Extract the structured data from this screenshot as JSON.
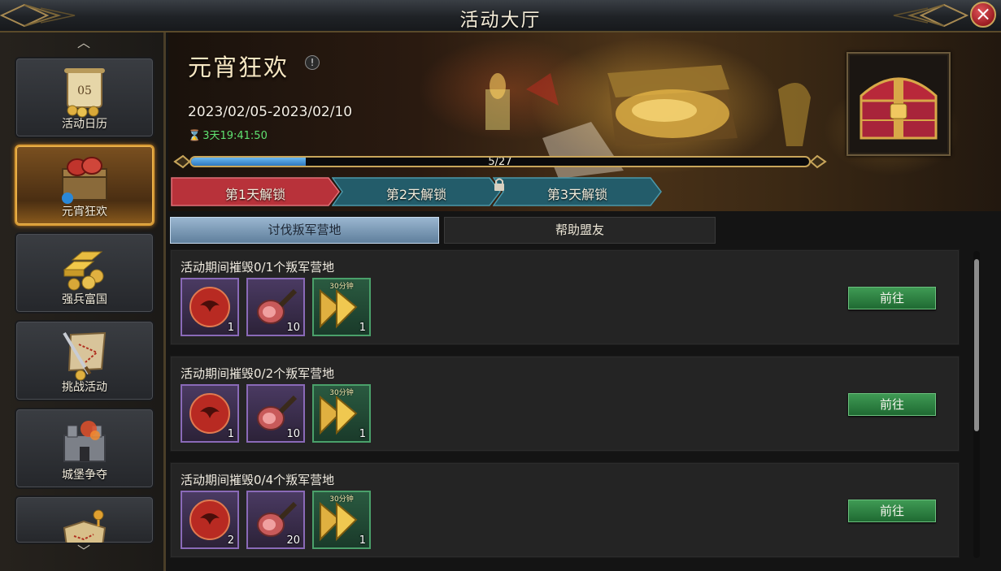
{
  "window": {
    "title": "活动大厅",
    "close_icon": "×"
  },
  "sidebar": {
    "scroll_up_icon": "︿",
    "scroll_down_icon": "﹀",
    "items": [
      {
        "label": "活动日历",
        "icon": "calendar-scroll-icon"
      },
      {
        "label": "元宵狂欢",
        "icon": "treasure-crate-icon",
        "active": true
      },
      {
        "label": "强兵富国",
        "icon": "gold-bars-icon"
      },
      {
        "label": "挑战活动",
        "icon": "sword-map-icon"
      },
      {
        "label": "城堡争夺",
        "icon": "castle-icon"
      },
      {
        "label": "",
        "icon": "treasure-map-icon"
      }
    ]
  },
  "event": {
    "title": "元宵狂欢",
    "info_icon": "!",
    "dates": "2023/02/05-2023/02/10",
    "countdown": "3天19:41:50",
    "hourglass_icon": "⌛",
    "progress_text": "5/27",
    "progress_fraction": 0.185,
    "reward_chest_icon": "red-treasure-chest-icon"
  },
  "day_tabs": [
    {
      "label": "第1天解锁",
      "state": "active",
      "color": "#b8323a"
    },
    {
      "label": "第2天解锁",
      "state": "unlocked",
      "color": "#2b6f80"
    },
    {
      "label": "第3天解锁",
      "state": "locked",
      "color": "#2b6f80"
    }
  ],
  "sub_tabs": [
    {
      "label": "讨伐叛军营地",
      "active": true
    },
    {
      "label": "帮助盟友",
      "active": false
    }
  ],
  "quests": [
    {
      "title": "活动期间摧毁0/1个叛军营地",
      "rewards": [
        {
          "icon": "dragon-orb-icon",
          "qty": "1",
          "tag": ""
        },
        {
          "icon": "meat-ham-icon",
          "qty": "10",
          "tag": ""
        },
        {
          "icon": "speedup-arrow-icon",
          "qty": "1",
          "tag": "30分钟"
        }
      ],
      "button": "前往"
    },
    {
      "title": "活动期间摧毁0/2个叛军营地",
      "rewards": [
        {
          "icon": "dragon-orb-icon",
          "qty": "1",
          "tag": ""
        },
        {
          "icon": "meat-ham-icon",
          "qty": "10",
          "tag": ""
        },
        {
          "icon": "speedup-arrow-icon",
          "qty": "1",
          "tag": "30分钟"
        }
      ],
      "button": "前往"
    },
    {
      "title": "活动期间摧毁0/4个叛军营地",
      "rewards": [
        {
          "icon": "dragon-orb-icon",
          "qty": "2",
          "tag": ""
        },
        {
          "icon": "meat-ham-icon",
          "qty": "20",
          "tag": ""
        },
        {
          "icon": "speedup-arrow-icon",
          "qty": "1",
          "tag": "30分钟"
        }
      ],
      "button": "前往"
    }
  ]
}
